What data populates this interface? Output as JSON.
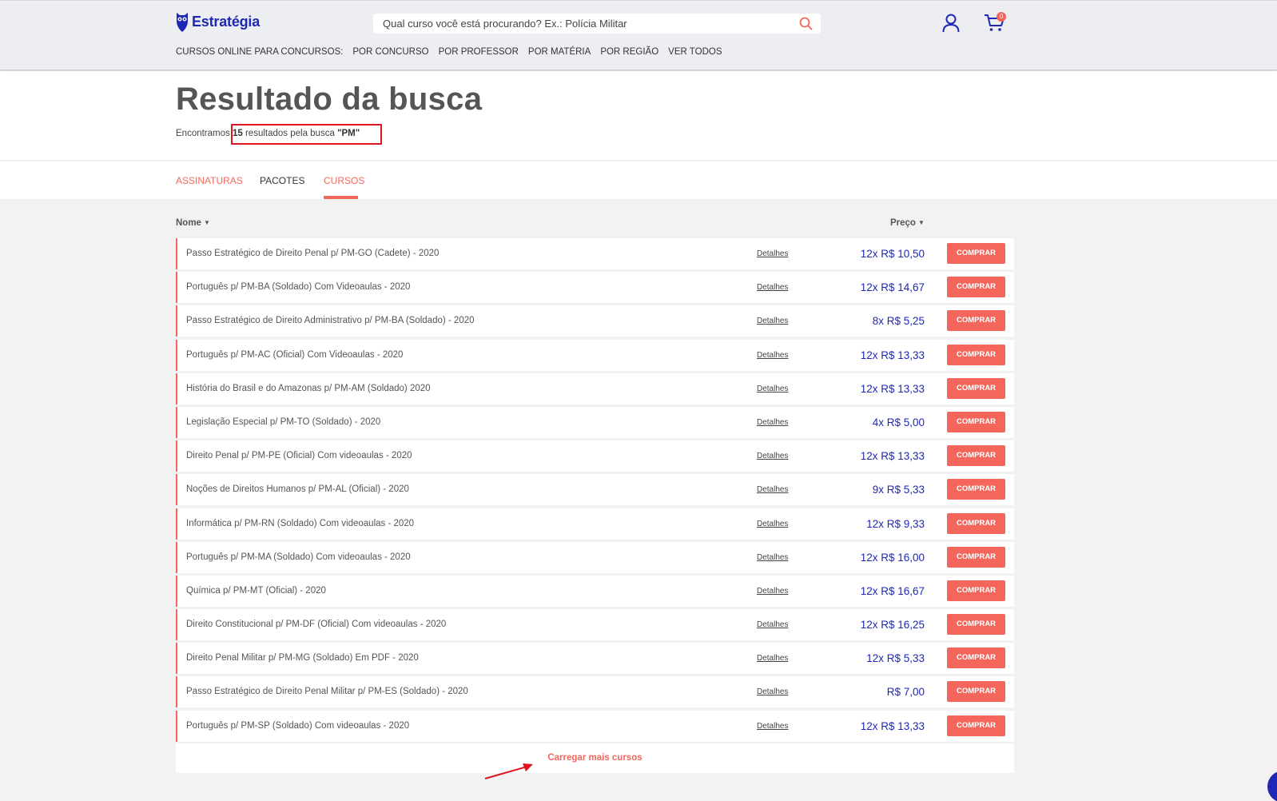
{
  "brand": {
    "name": "Estratégia"
  },
  "search": {
    "placeholder": "Qual curso você está procurando? Ex.: Polícia Militar"
  },
  "cart": {
    "count": "0"
  },
  "nav": {
    "label": "CURSOS ONLINE PARA CONCURSOS:",
    "items": [
      "POR CONCURSO",
      "POR PROFESSOR",
      "POR MATÉRIA",
      "POR REGIÃO",
      "VER TODOS"
    ]
  },
  "result": {
    "title": "Resultado da busca",
    "prefix": "Encontramos",
    "count": "15",
    "middle": "resultados pela busca",
    "query": "\"PM\""
  },
  "tabs": [
    "ASSINATURAS",
    "PACOTES",
    "CURSOS"
  ],
  "table": {
    "col_name": "Nome",
    "col_price": "Preço",
    "detail_label": "Detalhes",
    "buy_label": "COMPRAR",
    "rows": [
      {
        "name": "Passo Estratégico de Direito Penal p/ PM-GO (Cadete) - 2020",
        "price": "12x R$ 10,50"
      },
      {
        "name": "Português p/ PM-BA (Soldado) Com Videoaulas - 2020",
        "price": "12x R$ 14,67"
      },
      {
        "name": "Passo Estratégico de Direito Administrativo p/ PM-BA (Soldado) - 2020",
        "price": "8x R$ 5,25"
      },
      {
        "name": "Português p/ PM-AC (Oficial) Com Videoaulas - 2020",
        "price": "12x R$ 13,33"
      },
      {
        "name": "História do Brasil e do Amazonas p/ PM-AM (Soldado) 2020",
        "price": "12x R$ 13,33"
      },
      {
        "name": "Legislação Especial p/ PM-TO (Soldado) - 2020",
        "price": "4x R$ 5,00"
      },
      {
        "name": "Direito Penal p/ PM-PE (Oficial) Com videoaulas - 2020",
        "price": "12x R$ 13,33"
      },
      {
        "name": "Noções de Direitos Humanos p/ PM-AL (Oficial) - 2020",
        "price": "9x R$ 5,33"
      },
      {
        "name": "Informática p/ PM-RN (Soldado) Com videoaulas - 2020",
        "price": "12x R$ 9,33"
      },
      {
        "name": "Português p/ PM-MA (Soldado) Com videoaulas - 2020",
        "price": "12x R$ 16,00"
      },
      {
        "name": "Química p/ PM-MT (Oficial) - 2020",
        "price": "12x R$ 16,67"
      },
      {
        "name": "Direito Constitucional p/ PM-DF (Oficial) Com videoaulas - 2020",
        "price": "12x R$ 16,25"
      },
      {
        "name": "Direito Penal Militar p/ PM-MG (Soldado) Em PDF - 2020",
        "price": "12x R$ 5,33"
      },
      {
        "name": "Passo Estratégico de Direito Penal Militar p/ PM-ES (Soldado) - 2020",
        "price": "R$ 7,00"
      },
      {
        "name": "Português p/ PM-SP (Soldado) Com videoaulas - 2020",
        "price": "12x R$ 13,33"
      }
    ]
  },
  "load_more": "Carregar mais cursos",
  "colors": {
    "brand_blue": "#1e28b4",
    "accent": "#f4665b",
    "annotation_red": "#e0141e"
  }
}
